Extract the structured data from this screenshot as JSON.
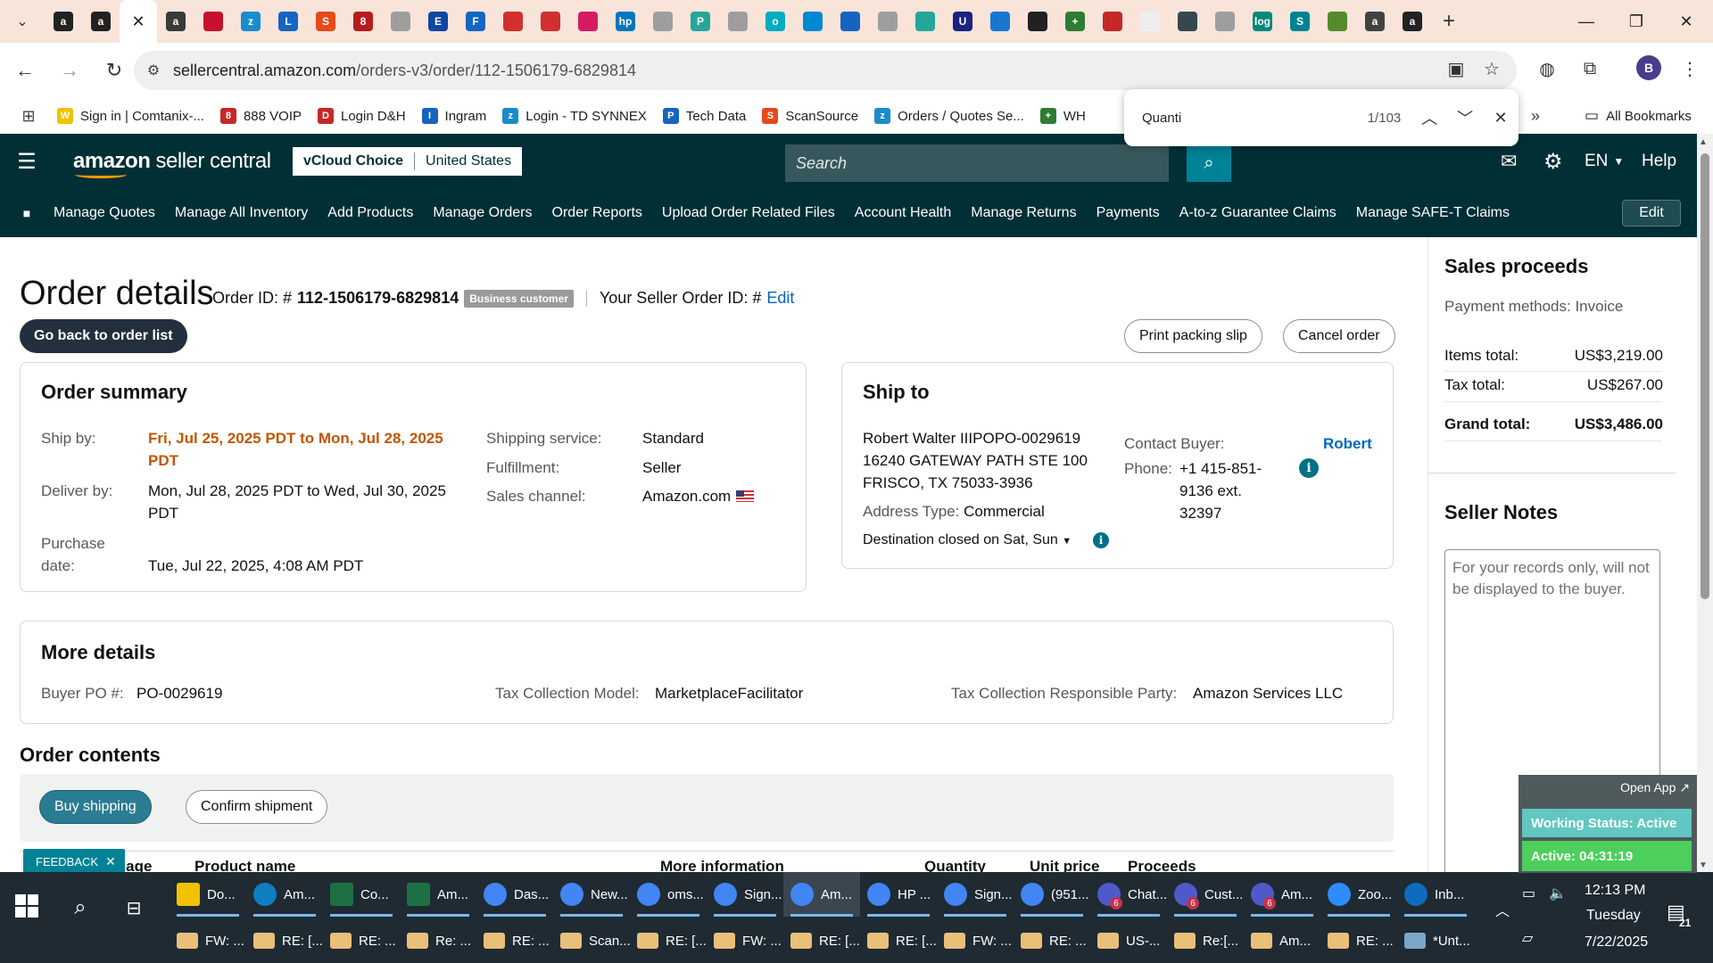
{
  "browser": {
    "tab_icons": [
      {
        "name": "amazon-tab-icon",
        "bg": "#222",
        "fg": "a"
      },
      {
        "name": "amazon-tab-icon",
        "bg": "#222",
        "fg": "a"
      },
      {
        "name": "amazon-circle-tab-icon",
        "bg": "#3a3a3a",
        "fg": "a"
      },
      {
        "name": "red-circle-tab-icon",
        "bg": "#c8102e",
        "fg": ""
      },
      {
        "name": "zc-tab-icon",
        "bg": "#1a8ccb",
        "fg": "z"
      },
      {
        "name": "blue-tab-icon",
        "bg": "#1565c0",
        "fg": "L"
      },
      {
        "name": "scansource-tab-icon",
        "bg": "#e64a19",
        "fg": "S"
      },
      {
        "name": "888-tab-icon",
        "bg": "#b71c1c",
        "fg": "8"
      },
      {
        "name": "globe-tab-icon",
        "bg": "#9e9e9e",
        "fg": ""
      },
      {
        "name": "etn-tab-icon",
        "bg": "#0d47a1",
        "fg": "E"
      },
      {
        "name": "f-tab-icon",
        "bg": "#1565c0",
        "fg": "F"
      },
      {
        "name": "red-tab-icon",
        "bg": "#d32f2f",
        "fg": ""
      },
      {
        "name": "red-tab-icon",
        "bg": "#d32f2f",
        "fg": ""
      },
      {
        "name": "pink-tab-icon",
        "bg": "#d81b60",
        "fg": ""
      },
      {
        "name": "hp-tab-icon",
        "bg": "#0277bd",
        "fg": "hp"
      },
      {
        "name": "globe-tab-icon",
        "bg": "#9e9e9e",
        "fg": ""
      },
      {
        "name": "p-tab-icon",
        "bg": "#26a69a",
        "fg": "P"
      },
      {
        "name": "globe-tab-icon",
        "bg": "#9e9e9e",
        "fg": ""
      },
      {
        "name": "o-tab-icon",
        "bg": "#00acc1",
        "fg": "o"
      },
      {
        "name": "cloud-tab-icon",
        "bg": "#0288d1",
        "fg": ""
      },
      {
        "name": "arrow-tab-icon",
        "bg": "#1565c0",
        "fg": ""
      },
      {
        "name": "globe-tab-icon",
        "bg": "#9e9e9e",
        "fg": ""
      },
      {
        "name": "teal-tab-icon",
        "bg": "#26a69a",
        "fg": ""
      },
      {
        "name": "u-tab-icon",
        "bg": "#1a237e",
        "fg": "U"
      },
      {
        "name": "blue-cloud-tab-icon",
        "bg": "#1976d2",
        "fg": ""
      },
      {
        "name": "dark-circle-tab-icon",
        "bg": "#212121",
        "fg": ""
      },
      {
        "name": "plus-green-tab-icon",
        "bg": "#2e7d32",
        "fg": "+"
      },
      {
        "name": "dh-tab-icon",
        "bg": "#c62828",
        "fg": ""
      },
      {
        "name": "white-tab-icon",
        "bg": "#eeeeee",
        "fg": ""
      },
      {
        "name": "tool-tab-icon",
        "bg": "#37474f",
        "fg": ""
      },
      {
        "name": "globe-tab-icon",
        "bg": "#9e9e9e",
        "fg": ""
      },
      {
        "name": "log-tab-icon",
        "bg": "#00897b",
        "fg": "log"
      },
      {
        "name": "s-circle-tab-icon",
        "bg": "#00838f",
        "fg": "S"
      },
      {
        "name": "green-circle-tab-icon",
        "bg": "#558b2f",
        "fg": ""
      },
      {
        "name": "amazon-circle-tab-icon",
        "bg": "#424242",
        "fg": "a"
      },
      {
        "name": "amazon-tab-icon",
        "bg": "#222",
        "fg": "a"
      }
    ],
    "url_host": "sellercentral.amazon.com",
    "url_path": "/orders-v3/order/112-1506179-6829814",
    "profile_initial": "B",
    "bookmarks": [
      {
        "label": "Sign in | Comtanix-...",
        "color": "#f2c200",
        "glyph": "W"
      },
      {
        "label": "888 VOIP",
        "color": "#c62828",
        "glyph": "8"
      },
      {
        "label": "Login D&H",
        "color": "#c62828",
        "glyph": "D"
      },
      {
        "label": "Ingram",
        "color": "#1565c0",
        "glyph": "I"
      },
      {
        "label": "Login - TD SYNNEX",
        "color": "#1a8ccb",
        "glyph": "z"
      },
      {
        "label": "Tech Data",
        "color": "#1565c0",
        "glyph": "P"
      },
      {
        "label": "ScanSource",
        "color": "#e64a19",
        "glyph": "S"
      },
      {
        "label": "Orders / Quotes Se...",
        "color": "#1a8ccb",
        "glyph": "z"
      },
      {
        "label": "WH",
        "color": "#2e7d32",
        "glyph": "+"
      }
    ],
    "all_bookmarks": "All Bookmarks",
    "find": {
      "query": "Quanti",
      "count": "1/103"
    }
  },
  "header": {
    "logo_bold": "amazon",
    "logo_light": " seller central",
    "store_name": "vCloud Choice",
    "marketplace": "United States",
    "search_placeholder": "Search",
    "lang": "EN",
    "help": "Help"
  },
  "nav": {
    "items": [
      "Manage Quotes",
      "Manage All Inventory",
      "Add Products",
      "Manage Orders",
      "Order Reports",
      "Upload Order Related Files",
      "Account Health",
      "Manage Returns",
      "Payments",
      "A-to-z Guarantee Claims",
      "Manage SAFE-T Claims"
    ],
    "edit": "Edit"
  },
  "order": {
    "title": "Order details",
    "order_id_label": "Order ID: #",
    "order_id": "112-1506179-6829814",
    "badge": "Business customer",
    "seller_order_label": "Your Seller Order ID: #",
    "seller_order_edit": "Edit",
    "back_button": "Go back to order list",
    "print_button": "Print packing slip",
    "cancel_button": "Cancel order"
  },
  "summary": {
    "title": "Order summary",
    "ship_by_label": "Ship by:",
    "ship_by_line1": "Fri, Jul 25, 2025 PDT to Mon, Jul 28, 2025",
    "ship_by_line2": "PDT",
    "deliver_by_label": "Deliver by:",
    "deliver_by_line1": "Mon, Jul 28, 2025 PDT to Wed, Jul 30, 2025",
    "deliver_by_line2": "PDT",
    "purchase_label_1": "Purchase",
    "purchase_label_2": "date:",
    "purchase_date": "Tue, Jul 22, 2025, 4:08 AM PDT",
    "shipping_service_label": "Shipping service:",
    "shipping_service": "Standard",
    "fulfillment_label": "Fulfillment:",
    "fulfillment": "Seller",
    "sales_channel_label": "Sales channel:",
    "sales_channel": "Amazon.com"
  },
  "ship_to": {
    "title": "Ship to",
    "name": "Robert Walter IIIPOPO-0029619",
    "street": "16240 GATEWAY PATH STE 100",
    "city": "FRISCO, TX 75033-3936",
    "address_type_label": "Address Type:",
    "address_type": "Commercial",
    "destination_note": "Destination closed on Sat, Sun",
    "contact_label": "Contact Buyer:",
    "contact_name": "Robert",
    "phone_label": "Phone:",
    "phone_line1": "+1 415-851-",
    "phone_line2": "9136 ext.",
    "phone_line3": "32397"
  },
  "more_details": {
    "title": "More details",
    "buyer_po_label": "Buyer PO #:",
    "buyer_po": "PO-0029619",
    "tax_model_label": "Tax Collection Model:",
    "tax_model": "MarketplaceFacilitator",
    "tax_party_label": "Tax Collection Responsible Party:",
    "tax_party": "Amazon Services LLC"
  },
  "contents": {
    "title": "Order contents",
    "buy_shipping": "Buy shipping",
    "confirm_shipment": "Confirm shipment",
    "col_image": "mage",
    "col_product": "Product name",
    "col_more": "More information",
    "col_qty": "Quantity",
    "col_price": "Unit price",
    "col_proceeds": "Proceeds",
    "feedback": "FEEDBACK"
  },
  "proceeds": {
    "title": "Sales proceeds",
    "payment_methods": "Payment methods: Invoice",
    "items_total_label": "Items total:",
    "items_total": "US$3,219.00",
    "tax_total_label": "Tax total:",
    "tax_total": "US$267.00",
    "grand_total_label": "Grand total:",
    "grand_total": "US$3,486.00"
  },
  "seller_notes": {
    "title": "Seller Notes",
    "placeholder": "For your records only, will not be displayed to the buyer."
  },
  "widget": {
    "open_app": "Open App ↗",
    "working_status": "Working Status: Active",
    "active_time": "Active: 04:31:19"
  },
  "taskbar": {
    "row1": [
      {
        "label": "Do...",
        "icon": "file-explorer-icon",
        "color": "#f2c200"
      },
      {
        "label": "Am...",
        "icon": "edge-icon",
        "color": "#0f7dc2"
      },
      {
        "label": "Co...",
        "icon": "excel-icon",
        "color": "#1d7044"
      },
      {
        "label": "Am...",
        "icon": "excel-icon",
        "color": "#1d7044"
      },
      {
        "label": "Das...",
        "icon": "chrome-icon",
        "color": "#4285f4"
      },
      {
        "label": "New...",
        "icon": "chrome-icon",
        "color": "#4285f4"
      },
      {
        "label": "oms...",
        "icon": "chrome-icon",
        "color": "#4285f4"
      },
      {
        "label": "Sign...",
        "icon": "chrome-icon",
        "color": "#4285f4"
      },
      {
        "label": "Am...",
        "icon": "chrome-icon",
        "color": "#4285f4"
      },
      {
        "label": "HP ...",
        "icon": "chrome-icon",
        "color": "#4285f4"
      },
      {
        "label": "Sign...",
        "icon": "chrome-icon",
        "color": "#4285f4"
      },
      {
        "label": "(951...",
        "icon": "chrome-icon",
        "color": "#4285f4"
      },
      {
        "label": "Chat...",
        "icon": "teams-icon",
        "color": "#5059c9"
      },
      {
        "label": "Cust...",
        "icon": "teams-icon",
        "color": "#5059c9"
      },
      {
        "label": "Am...",
        "icon": "teams-icon",
        "color": "#5059c9"
      },
      {
        "label": "Zoo...",
        "icon": "zoom-icon",
        "color": "#2d8cff"
      },
      {
        "label": "Inb...",
        "icon": "outlook-icon",
        "color": "#0f6cbd"
      }
    ],
    "row2": [
      {
        "label": "FW: ...",
        "icon": "mail-icon"
      },
      {
        "label": "RE: [...",
        "icon": "mail-icon"
      },
      {
        "label": "RE: ...",
        "icon": "mail-icon"
      },
      {
        "label": "Re: ...",
        "icon": "mail-icon"
      },
      {
        "label": "RE: ...",
        "icon": "mail-icon"
      },
      {
        "label": "Scan...",
        "icon": "mail-icon"
      },
      {
        "label": "RE: [...",
        "icon": "mail-icon"
      },
      {
        "label": "FW: ...",
        "icon": "mail-icon"
      },
      {
        "label": "RE: [...",
        "icon": "mail-icon"
      },
      {
        "label": "RE: [...",
        "icon": "mail-icon"
      },
      {
        "label": "FW: ...",
        "icon": "mail-icon"
      },
      {
        "label": "RE: ...",
        "icon": "mail-icon"
      },
      {
        "label": "US-...",
        "icon": "mail-icon"
      },
      {
        "label": "Re:[...",
        "icon": "mail-icon"
      },
      {
        "label": "Am...",
        "icon": "mail-icon"
      },
      {
        "label": "RE: ...",
        "icon": "mail-icon"
      },
      {
        "label": "*Unt...",
        "icon": "notepad-icon"
      }
    ],
    "time": "12:13 PM",
    "day": "Tuesday",
    "date": "7/22/2025",
    "notifications": "21",
    "teams_badge": "6"
  }
}
